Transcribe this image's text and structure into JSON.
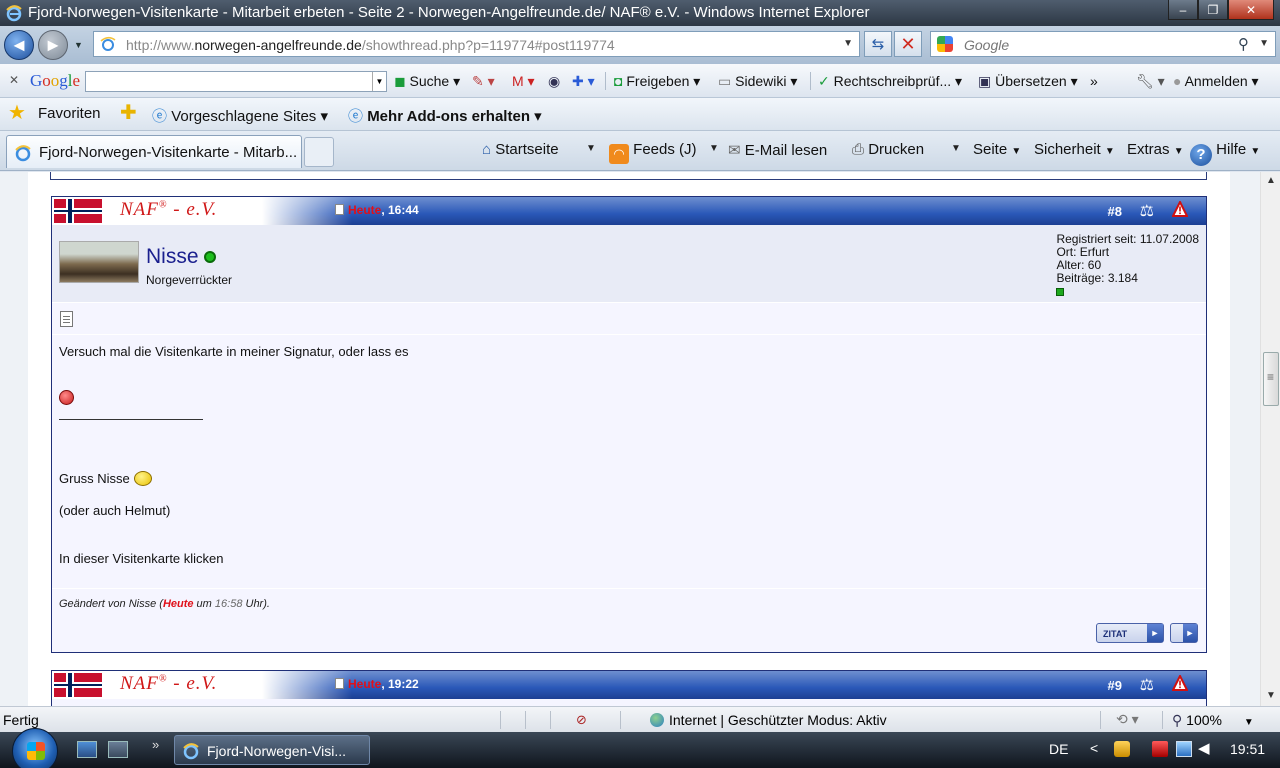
{
  "window": {
    "title": "Fjord-Norwegen-Visitenkarte - Mitarbeit erbeten - Seite 2 - Norwegen-Angelfreunde.de/ NAF® e.V. - Windows Internet Explorer",
    "minimize": "–",
    "maximize": "❐",
    "close": "✕"
  },
  "address": {
    "url_prefix": "http://www.",
    "url_domain": "norwegen-angelfreunde.de",
    "url_path": "/showthread.php?p=119774#post119774",
    "back": "◄",
    "forward": "►",
    "refresh": "⇆",
    "stop": "✕"
  },
  "search": {
    "placeholder": "Google"
  },
  "google_toolbar": {
    "close": "✕",
    "logo": [
      "G",
      "o",
      "o",
      "g",
      "l",
      "e"
    ],
    "items": {
      "suche": "Suche",
      "freigeben": "Freigeben",
      "sidewiki": "Sidewiki",
      "rechtschreib": "Rechtschreibprüf...",
      "uebersetzen": "Übersetzen",
      "more": "»",
      "anmelden": "Anmelden"
    }
  },
  "favorites_bar": {
    "favoriten": "Favoriten",
    "vorgeschlagene": "Vorgeschlagene Sites",
    "addons": "Mehr Add-ons erhalten"
  },
  "tab": {
    "label": "Fjord-Norwegen-Visitenkarte - Mitarb..."
  },
  "command_bar": {
    "startseite": "Startseite",
    "feeds": "Feeds (J)",
    "email": "E-Mail lesen",
    "drucken": "Drucken",
    "seite": "Seite",
    "sicherheit": "Sicherheit",
    "extras": "Extras",
    "hilfe": "Hilfe"
  },
  "posts": [
    {
      "logo": "NAF",
      "logo_rest": "- e.V.",
      "date_today": "Heute",
      "time": ", 16:44",
      "number": "#8",
      "user": {
        "name": "Nisse",
        "title": "Norgeverrückter",
        "info": [
          "Registriert seit: 11.07.2008",
          "Ort: Erfurt",
          "Alter: 60",
          "Beiträge: 3.184"
        ]
      },
      "body": {
        "line1": "Versuch mal die Visitenkarte in meiner Signatur, oder lass es",
        "gruss": "Gruss Nisse",
        "oder": "(oder auch Helmut)",
        "visitenkarte": "In dieser Visitenkarte klicken"
      },
      "edited": {
        "prefix": "Geändert von Nisse (",
        "today": "Heute",
        "um": " um ",
        "time": "16:58",
        "suffix": " Uhr)."
      },
      "quote_button": "ZITAT"
    },
    {
      "logo": "NAF",
      "logo_rest": "- e.V.",
      "date_today": "Heute",
      "time": ", 19:22",
      "number": "#9"
    }
  ],
  "statusbar": {
    "status": "Fertig",
    "zone": "Internet | Geschützter Modus: Aktiv",
    "zoom": "100%"
  },
  "taskbar": {
    "task": "Fjord-Norwegen-Visi...",
    "lang": "DE",
    "clock": "19:51",
    "more": "»",
    "tray_arrow": "<"
  }
}
